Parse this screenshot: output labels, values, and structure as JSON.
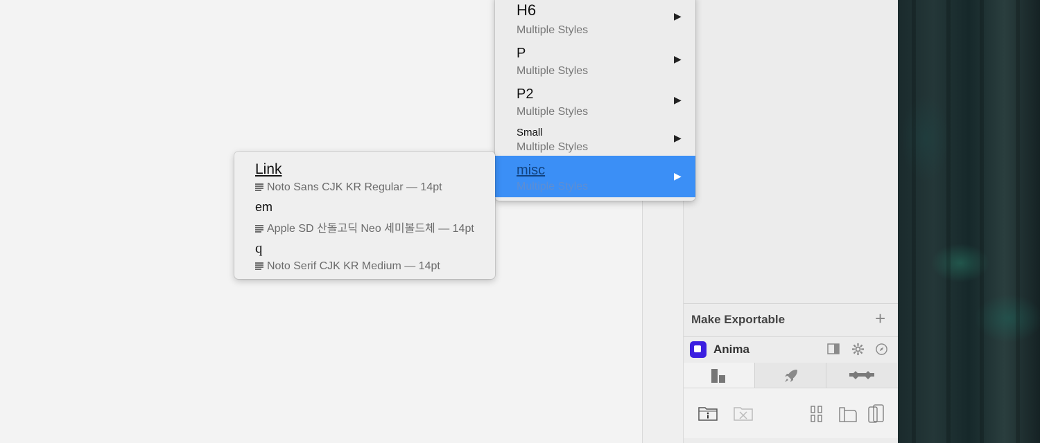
{
  "style_menu": {
    "items": [
      {
        "title": "H6",
        "subtitle": "Multiple Styles"
      },
      {
        "title": "P",
        "subtitle": "Multiple Styles"
      },
      {
        "title": "P2",
        "subtitle": "Multiple Styles"
      },
      {
        "title": "Small",
        "subtitle": "Multiple Styles"
      },
      {
        "title": "misc",
        "subtitle": "Multiple Styles"
      }
    ],
    "arrow_glyph": "▶",
    "active_index": 4,
    "accent_color": "#3b8ff6"
  },
  "submenu": {
    "items": [
      {
        "name": "Link",
        "desc": "Noto Sans CJK KR Regular — 14pt"
      },
      {
        "name": "em",
        "desc": "Apple SD 산돌고딕 Neo 세미볼드체 — 14pt"
      },
      {
        "name": "q",
        "desc": "Noto Serif CJK KR Medium — 14pt"
      }
    ],
    "desc_icon": "text-lines-icon"
  },
  "inspector": {
    "make_exportable": "Make Exportable",
    "add_glyph": "+",
    "plugin_name": "Anima",
    "plugin_color": "#3b1fe0",
    "tabs": [
      "layout-tab",
      "launch-tab",
      "link-tab"
    ],
    "selected_tab": 0
  }
}
